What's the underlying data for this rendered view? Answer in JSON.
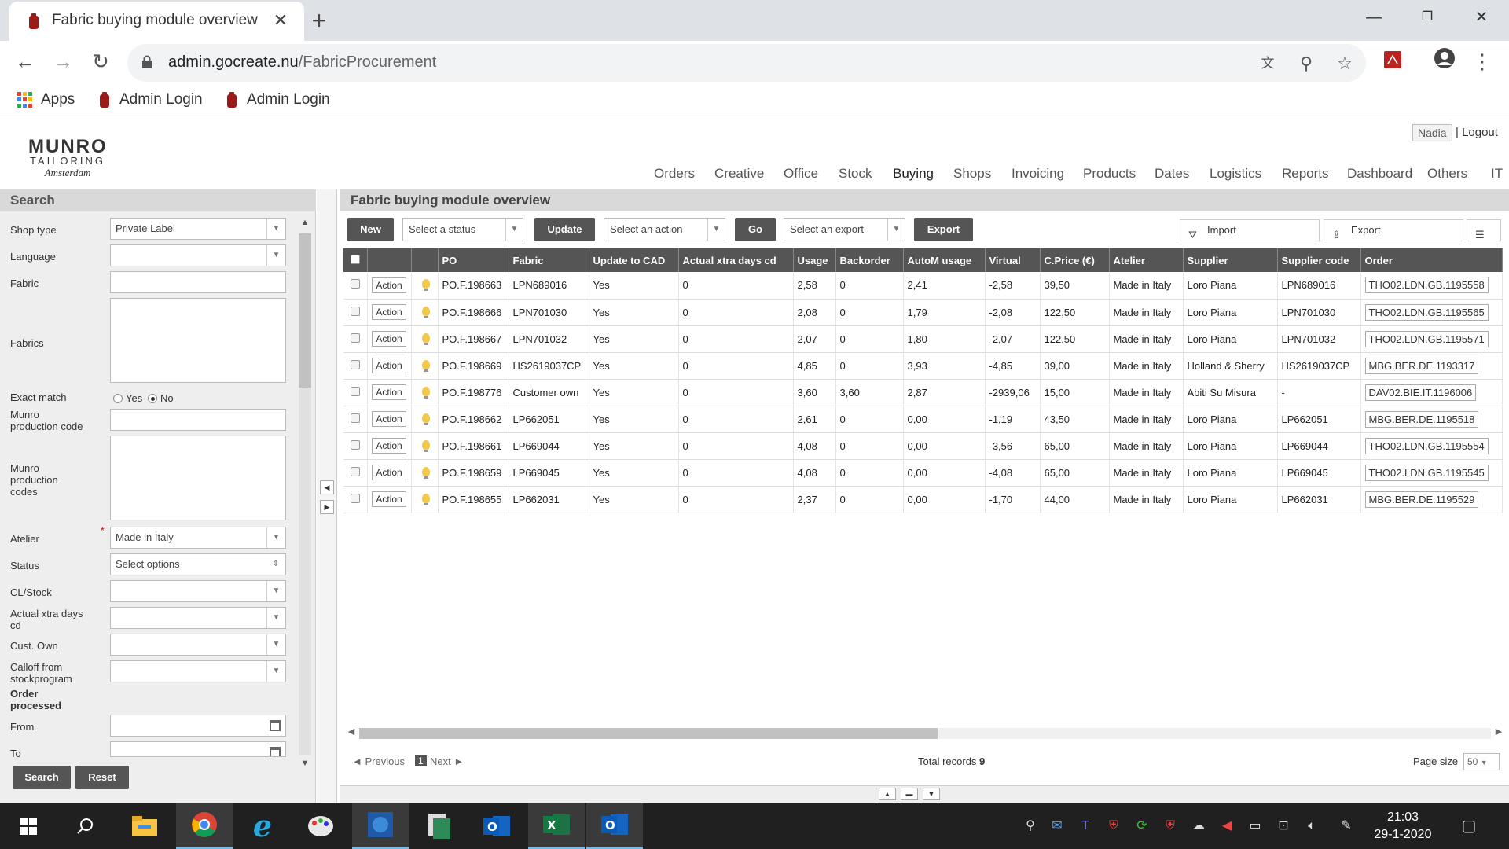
{
  "browser": {
    "tab_title": "Fabric buying module overview",
    "url_domain": "admin.gocreate.nu",
    "url_path": "/FabricProcurement",
    "bookmarks": [
      "Apps",
      "Admin Login",
      "Admin Login"
    ]
  },
  "header": {
    "logo_line1": "MUNRO",
    "logo_line2": "TAILORING",
    "logo_line3": "Amsterdam",
    "user": "Nadia",
    "logout": "| Logout",
    "nav": [
      "Orders",
      "Creative",
      "Office",
      "Stock",
      "Buying",
      "Shops",
      "Invoicing",
      "Products",
      "Dates",
      "Logistics",
      "Reports",
      "Dashboard",
      "Others",
      "IT"
    ]
  },
  "search": {
    "title": "Search",
    "shop_type_label": "Shop type",
    "shop_type_value": "Private Label",
    "language_label": "Language",
    "fabric_label": "Fabric",
    "fabrics_label": "Fabrics",
    "exact_match_label": "Exact match",
    "yes": "Yes",
    "no": "No",
    "munro_code_label_1": "Munro",
    "munro_code_label_2": "production code",
    "munro_codes_label_1": "Munro",
    "munro_codes_label_2": "production",
    "munro_codes_label_3": "codes",
    "atelier_label": "Atelier",
    "atelier_value": "Made in Italy",
    "status_label": "Status",
    "status_value": "Select options",
    "clstock_label": "CL/Stock",
    "xtra_label_1": "Actual xtra days",
    "xtra_label_2": "cd",
    "custown_label": "Cust. Own",
    "calloff_label_1": "Calloff from",
    "calloff_label_2": "stockprogram",
    "order_processed_1": "Order",
    "order_processed_2": "processed",
    "from_label": "From",
    "to_label": "To",
    "search_btn": "Search",
    "reset_btn": "Reset"
  },
  "main": {
    "title": "Fabric buying module overview",
    "new_btn": "New",
    "status_select": "Select a status",
    "update_btn": "Update",
    "action_select": "Select an action",
    "go_btn": "Go",
    "export_select": "Select an export",
    "export_btn": "Export",
    "import_link": "Import",
    "export_link": "Export",
    "columns": [
      "PO",
      "Fabric",
      "Update to CAD",
      "Actual xtra days cd",
      "Usage",
      "Backorder",
      "AutoM usage",
      "Virtual",
      "C.Price (€)",
      "Atelier",
      "Supplier",
      "Supplier code",
      "Order"
    ],
    "action_label": "Action",
    "rows": [
      {
        "po": "PO.F.198663",
        "fabric": "LPN689016",
        "cad": "Yes",
        "xtra": "0",
        "usage": "2,58",
        "back": "0",
        "autom": "2,41",
        "virtual": "-2,58",
        "price": "39,50",
        "atelier": "Made in Italy",
        "supplier": "Loro Piana",
        "scode": "LPN689016",
        "order": "THO02.LDN.GB.1195558"
      },
      {
        "po": "PO.F.198666",
        "fabric": "LPN701030",
        "cad": "Yes",
        "xtra": "0",
        "usage": "2,08",
        "back": "0",
        "autom": "1,79",
        "virtual": "-2,08",
        "price": "122,50",
        "atelier": "Made in Italy",
        "supplier": "Loro Piana",
        "scode": "LPN701030",
        "order": "THO02.LDN.GB.1195565"
      },
      {
        "po": "PO.F.198667",
        "fabric": "LPN701032",
        "cad": "Yes",
        "xtra": "0",
        "usage": "2,07",
        "back": "0",
        "autom": "1,80",
        "virtual": "-2,07",
        "price": "122,50",
        "atelier": "Made in Italy",
        "supplier": "Loro Piana",
        "scode": "LPN701032",
        "order": "THO02.LDN.GB.1195571"
      },
      {
        "po": "PO.F.198669",
        "fabric": "HS2619037CP",
        "cad": "Yes",
        "xtra": "0",
        "usage": "4,85",
        "back": "0",
        "autom": "3,93",
        "virtual": "-4,85",
        "price": "39,00",
        "atelier": "Made in Italy",
        "supplier": "Holland & Sherry",
        "scode": "HS2619037CP",
        "order": "MBG.BER.DE.1193317"
      },
      {
        "po": "PO.F.198776",
        "fabric": "Customer own",
        "cad": "Yes",
        "xtra": "0",
        "usage": "3,60",
        "back": "3,60",
        "autom": "2,87",
        "virtual": "-2939,06",
        "price": "15,00",
        "atelier": "Made in Italy",
        "supplier": "Abiti Su Misura",
        "scode": "-",
        "order": "DAV02.BIE.IT.1196006"
      },
      {
        "po": "PO.F.198662",
        "fabric": "LP662051",
        "cad": "Yes",
        "xtra": "0",
        "usage": "2,61",
        "back": "0",
        "autom": "0,00",
        "virtual": "-1,19",
        "price": "43,50",
        "atelier": "Made in Italy",
        "supplier": "Loro Piana",
        "scode": "LP662051",
        "order": "MBG.BER.DE.1195518"
      },
      {
        "po": "PO.F.198661",
        "fabric": "LP669044",
        "cad": "Yes",
        "xtra": "0",
        "usage": "4,08",
        "back": "0",
        "autom": "0,00",
        "virtual": "-3,56",
        "price": "65,00",
        "atelier": "Made in Italy",
        "supplier": "Loro Piana",
        "scode": "LP669044",
        "order": "THO02.LDN.GB.1195554"
      },
      {
        "po": "PO.F.198659",
        "fabric": "LP669045",
        "cad": "Yes",
        "xtra": "0",
        "usage": "4,08",
        "back": "0",
        "autom": "0,00",
        "virtual": "-4,08",
        "price": "65,00",
        "atelier": "Made in Italy",
        "supplier": "Loro Piana",
        "scode": "LP669045",
        "order": "THO02.LDN.GB.1195545"
      },
      {
        "po": "PO.F.198655",
        "fabric": "LP662031",
        "cad": "Yes",
        "xtra": "0",
        "usage": "2,37",
        "back": "0",
        "autom": "0,00",
        "virtual": "-1,70",
        "price": "44,00",
        "atelier": "Made in Italy",
        "supplier": "Loro Piana",
        "scode": "LP662031",
        "order": "MBG.BER.DE.1195529"
      }
    ],
    "pager_prev": "◄ Previous",
    "pager_page": "1",
    "pager_next": "Next ►",
    "total_label": "Total records",
    "total_value": "9",
    "page_size_label": "Page size",
    "page_size_value": "50"
  },
  "taskbar": {
    "time": "21:03",
    "date": "29-1-2020"
  }
}
